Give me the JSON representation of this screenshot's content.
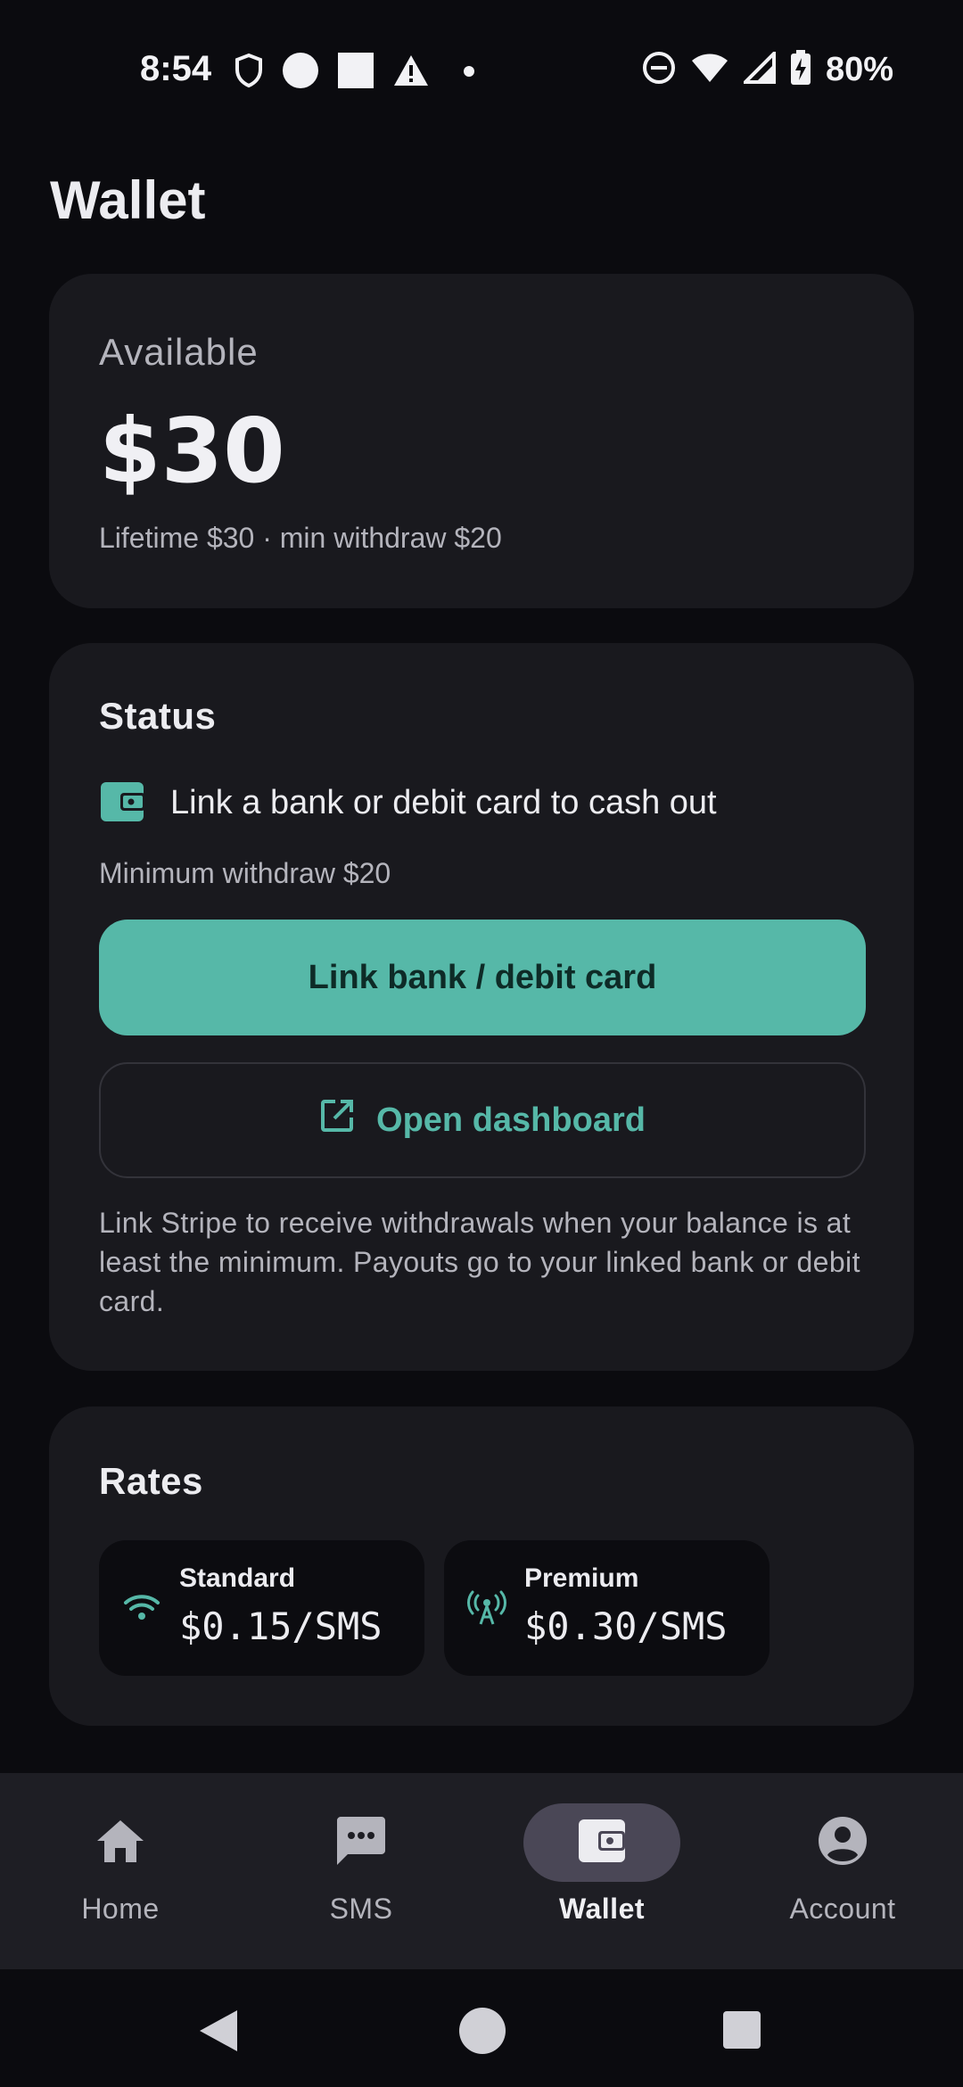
{
  "status_bar": {
    "time": "8:54",
    "battery": "80%",
    "icons": [
      "shield-icon",
      "circle-icon",
      "square-icon",
      "alert-icon",
      "dot-icon",
      "do-not-disturb-icon",
      "wifi-icon",
      "signal-icon",
      "battery-charging-icon"
    ]
  },
  "page": {
    "title": "Wallet"
  },
  "balance": {
    "label": "Available",
    "amount": "$30",
    "sub": "Lifetime $30 · min withdraw $20"
  },
  "status": {
    "heading": "Status",
    "message": "Link a bank or debit card to cash out",
    "min_withdraw": "Minimum withdraw $20",
    "primary_button": "Link bank / debit card",
    "secondary_button": "Open dashboard",
    "note": "Link Stripe to receive withdrawals when your balance is at least the minimum. Payouts go to your linked bank or debit card."
  },
  "rates": {
    "heading": "Rates",
    "items": [
      {
        "name": "Standard",
        "value": "$0.15/SMS",
        "icon": "wifi-icon"
      },
      {
        "name": "Premium",
        "value": "$0.30/SMS",
        "icon": "antenna-icon"
      }
    ]
  },
  "nav": {
    "items": [
      {
        "label": "Home",
        "icon": "home-icon",
        "active": false
      },
      {
        "label": "SMS",
        "icon": "chat-icon",
        "active": false
      },
      {
        "label": "Wallet",
        "icon": "wallet-icon",
        "active": true
      },
      {
        "label": "Account",
        "icon": "account-icon",
        "active": false
      }
    ]
  },
  "colors": {
    "background": "#0b0b0f",
    "card": "#19191e",
    "accent": "#56b8a8",
    "nav_bar": "#1e1e24",
    "nav_active_pill": "#4a4756"
  }
}
